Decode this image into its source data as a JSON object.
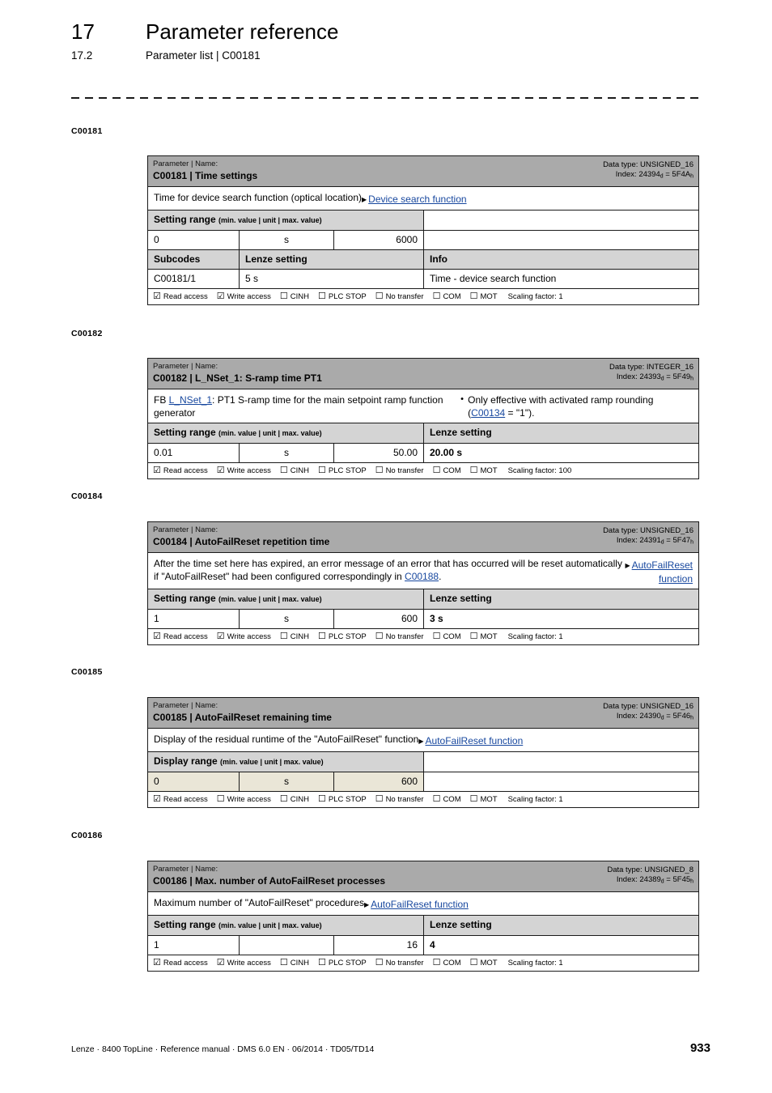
{
  "header": {
    "chapter_number": "17",
    "chapter_title": "Parameter reference",
    "section_number": "17.2",
    "section_title": "Parameter list | C00181"
  },
  "footer": {
    "text": "Lenze · 8400 TopLine · Reference manual · DMS 6.0 EN · 06/2014 · TD05/TD14",
    "page": "933"
  },
  "colors": {
    "title_bar": "#AAAAAA",
    "subheader": "#D4D4D4",
    "display_range_row": "#EAE6D7",
    "link": "#17479E",
    "border": "#1A1A1A"
  },
  "labels": {
    "parameter_name_caption": "Parameter | Name:",
    "data_type_prefix": "Data type: ",
    "index_prefix": "Index: ",
    "setting_range": "Setting range",
    "display_range": "Display range",
    "range_hint": "(min. value | unit | max. value)",
    "lenze_setting": "Lenze setting",
    "subcodes": "Subcodes",
    "info": "Info",
    "read_access": "Read access",
    "write_access": "Write access",
    "cinh": "CINH",
    "plc_stop": "PLC STOP",
    "no_transfer": "No transfer",
    "com": "COM",
    "mot": "MOT",
    "checked_glyph": "☑",
    "unchecked_glyph": "☐",
    "ref_arrow_glyph": "▶"
  },
  "blocks": [
    {
      "margin_label": "C00181",
      "code": "C00181",
      "name": "Time settings",
      "title": "C00181 | Time settings",
      "data_type": "UNSIGNED_16",
      "index_dec": "24394",
      "index_hex": "5F4A",
      "description": "Time for device search function (optical location)",
      "reference_link": "Device search function",
      "range_label": "Setting range",
      "range_kind": "setting",
      "min": "0",
      "unit": "s",
      "max": "6000",
      "right_header": "",
      "right_header_shaded": false,
      "lenze_setting": "",
      "subcode_table": {
        "columns": [
          "Subcodes",
          "Lenze setting",
          "Info"
        ],
        "rows": [
          [
            "C00181/1",
            "5 s",
            "Time - device search function"
          ]
        ]
      },
      "flags": {
        "read_access": true,
        "write_access": true,
        "cinh": false,
        "plc_stop": false,
        "no_transfer": false,
        "com": false,
        "mot": false
      },
      "scaling_factor": "Scaling factor: 1"
    },
    {
      "margin_label": "C00182",
      "code": "C00182",
      "name": "L_NSet_1: S-ramp time PT1",
      "title": "C00182 | L_NSet_1: S-ramp time PT1",
      "data_type": "INTEGER_16",
      "index_dec": "24393",
      "index_hex": "5F49",
      "description_parts": {
        "lead": "FB ",
        "link1": "L_NSet_1",
        "tail": ": PT1 S-ramp time for the main setpoint ramp function generator",
        "bullet_lead": "Only effective with activated ramp rounding (",
        "bullet_link": "C00134",
        "bullet_tail": " = \"1\")."
      },
      "reference_link": "",
      "range_label": "Setting range",
      "range_kind": "setting",
      "min": "0.01",
      "unit": "s",
      "max": "50.00",
      "right_header": "Lenze setting",
      "right_header_shaded": true,
      "lenze_setting": "20.00 s",
      "flags": {
        "read_access": true,
        "write_access": true,
        "cinh": false,
        "plc_stop": false,
        "no_transfer": false,
        "com": false,
        "mot": false
      },
      "scaling_factor": "Scaling factor: 100"
    },
    {
      "margin_label": "C00184",
      "code": "C00184",
      "name": "AutoFailReset repetition time",
      "title": "C00184 | AutoFailReset repetition time",
      "data_type": "UNSIGNED_16",
      "index_dec": "24391",
      "index_hex": "5F47",
      "description_parts": {
        "lead": "After the time set here has expired, an error message of an error that has occurred will be reset automatically if \"AutoFailReset\" had been configured correspondingly in ",
        "link1": "C00188",
        "tail": "."
      },
      "reference_link": "AutoFailReset function",
      "range_label": "Setting range",
      "range_kind": "setting",
      "min": "1",
      "unit": "s",
      "max": "600",
      "right_header": "Lenze setting",
      "right_header_shaded": true,
      "lenze_setting": "3 s",
      "flags": {
        "read_access": true,
        "write_access": true,
        "cinh": false,
        "plc_stop": false,
        "no_transfer": false,
        "com": false,
        "mot": false
      },
      "scaling_factor": "Scaling factor: 1"
    },
    {
      "margin_label": "C00185",
      "code": "C00185",
      "name": "AutoFailReset remaining time",
      "title": "C00185 | AutoFailReset remaining time",
      "data_type": "UNSIGNED_16",
      "index_dec": "24390",
      "index_hex": "5F46",
      "description": "Display of the residual runtime of the \"AutoFailReset\" function",
      "reference_link": "AutoFailReset function",
      "range_label": "Display range",
      "range_kind": "display",
      "min": "0",
      "unit": "s",
      "max": "600",
      "right_header": "",
      "right_header_shaded": false,
      "lenze_setting": "",
      "flags": {
        "read_access": true,
        "write_access": false,
        "cinh": false,
        "plc_stop": false,
        "no_transfer": false,
        "com": false,
        "mot": false
      },
      "scaling_factor": "Scaling factor: 1"
    },
    {
      "margin_label": "C00186",
      "code": "C00186",
      "name": "Max. number of AutoFailReset processes",
      "title": "C00186 | Max. number of AutoFailReset processes",
      "data_type": "UNSIGNED_8",
      "index_dec": "24389",
      "index_hex": "5F45",
      "description": "Maximum number of \"AutoFailReset\" procedures",
      "reference_link": "AutoFailReset function",
      "range_label": "Setting range",
      "range_kind": "setting",
      "min": "1",
      "unit": "",
      "max": "16",
      "right_header": "Lenze setting",
      "right_header_shaded": true,
      "lenze_setting": "4",
      "flags": {
        "read_access": true,
        "write_access": true,
        "cinh": false,
        "plc_stop": false,
        "no_transfer": false,
        "com": false,
        "mot": false
      },
      "scaling_factor": "Scaling factor: 1"
    }
  ]
}
